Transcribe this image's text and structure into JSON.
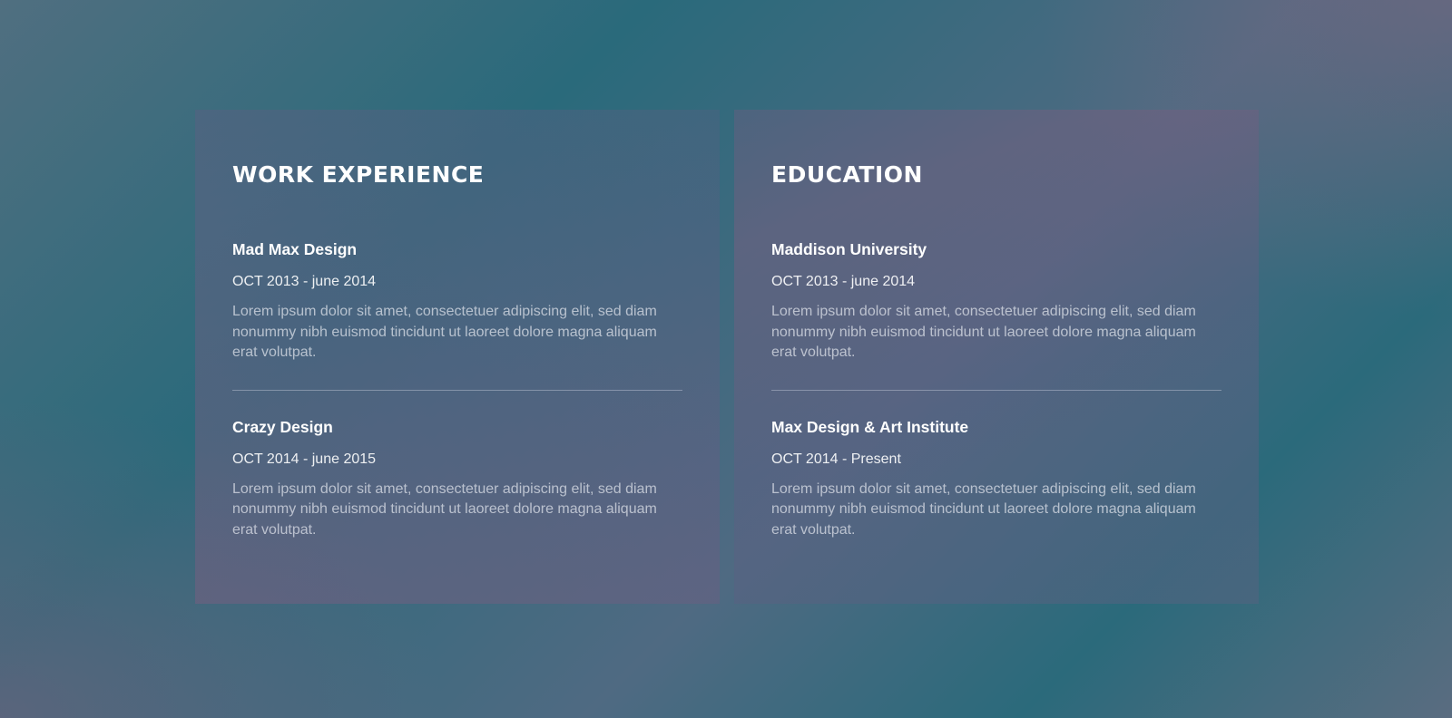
{
  "work": {
    "title": "WORK EXPERIENCE",
    "entries": [
      {
        "name": "Mad Max Design",
        "date": "OCT 2013 - june 2014",
        "description": "Lorem ipsum dolor sit amet, consectetuer adipiscing elit, sed diam nonummy nibh euismod tincidunt ut laoreet dolore magna aliquam erat volutpat."
      },
      {
        "name": "Crazy Design",
        "date": "OCT 2014 - june 2015",
        "description": "Lorem ipsum dolor sit amet, consectetuer adipiscing elit, sed diam nonummy nibh euismod tincidunt ut laoreet dolore magna aliquam erat volutpat."
      }
    ]
  },
  "education": {
    "title": "EDUCATION",
    "entries": [
      {
        "name": "Maddison University",
        "date": "OCT 2013 - june 2014",
        "description": "Lorem ipsum dolor sit amet, consectetuer adipiscing elit, sed diam nonummy nibh euismod tincidunt ut laoreet dolore magna aliquam erat volutpat."
      },
      {
        "name": "Max Design & Art Institute",
        "date": "OCT 2014 - Present",
        "description": "Lorem ipsum dolor sit amet, consectetuer adipiscing elit, sed diam nonummy nibh euismod tincidunt ut laoreet dolore magna aliquam erat volutpat."
      }
    ]
  }
}
